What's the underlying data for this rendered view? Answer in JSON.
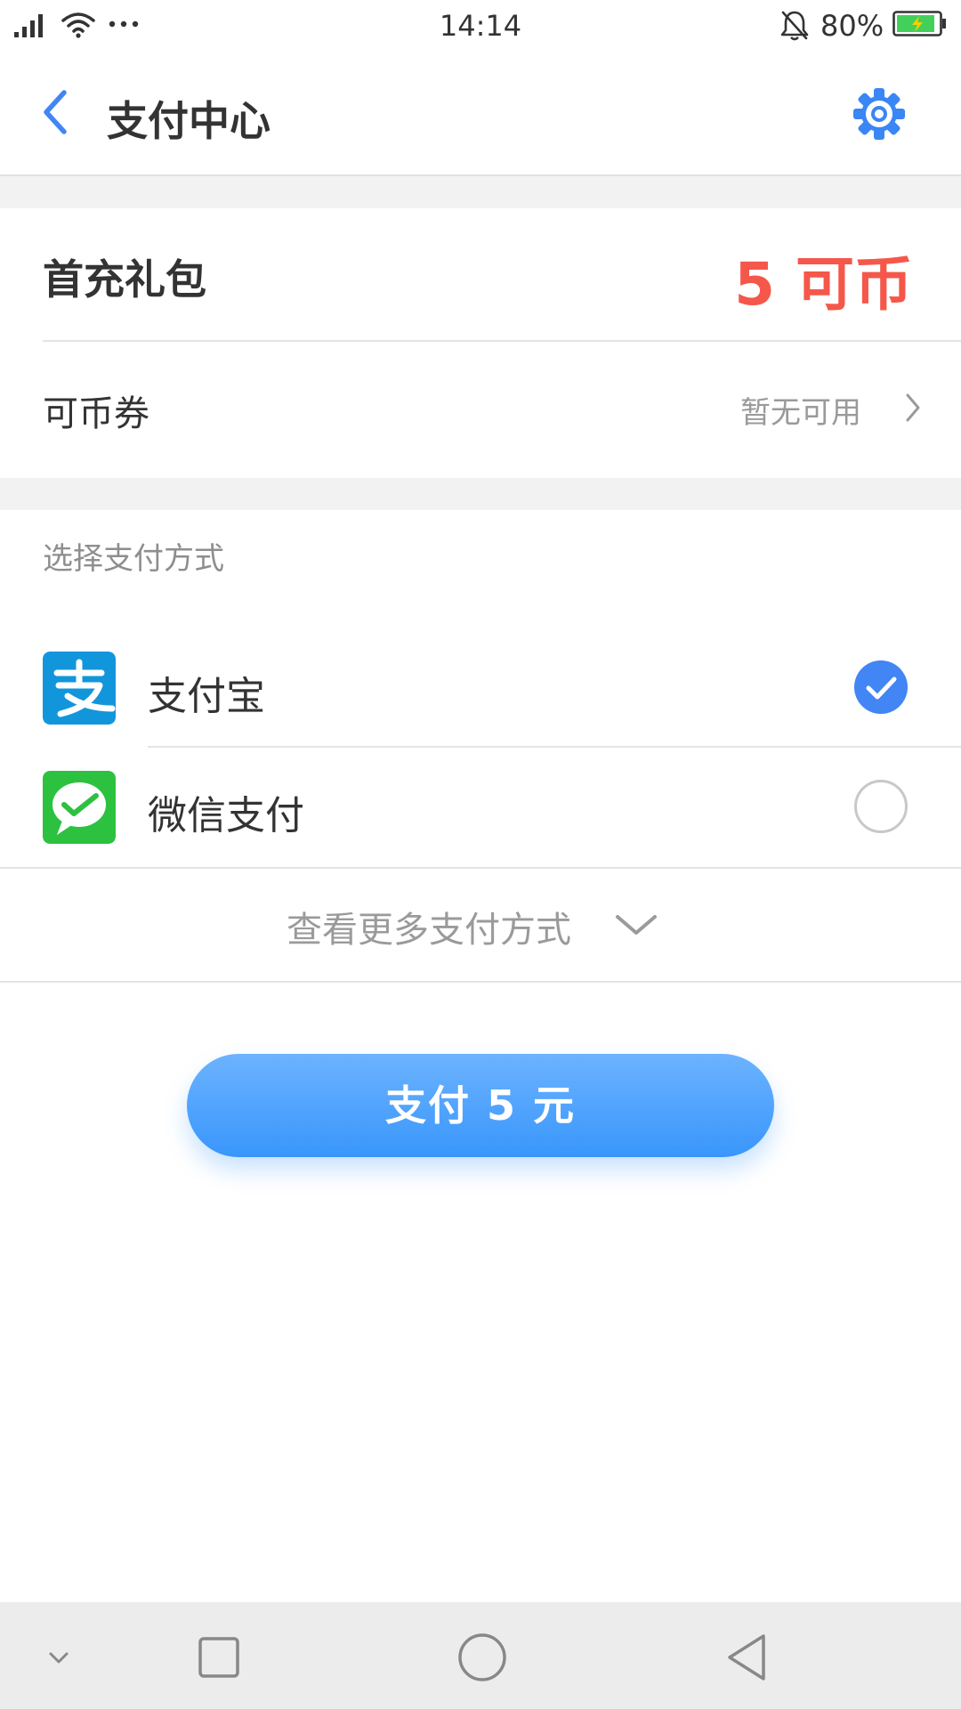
{
  "status_bar": {
    "time": "14:14",
    "battery_percent": "80%",
    "icons": [
      "signal-icon",
      "wifi-icon",
      "more-dots-icon",
      "bell-mute-icon",
      "battery-charging-icon"
    ]
  },
  "header": {
    "title": "支付中心",
    "back_icon": "back-arrow-icon",
    "settings_icon": "gear-icon"
  },
  "gift": {
    "label": "首充礼包",
    "value": "5 可币"
  },
  "coupon": {
    "label": "可币券",
    "status": "暂无可用"
  },
  "payment_methods": {
    "section_title": "选择支付方式",
    "items": [
      {
        "label": "支付宝",
        "icon": "alipay-icon",
        "selected": true
      },
      {
        "label": "微信支付",
        "icon": "wechat-pay-icon",
        "selected": false
      }
    ],
    "more_label": "查看更多支付方式"
  },
  "pay_button": {
    "label": "支付 5 元"
  },
  "colors": {
    "accent_blue": "#4285f4",
    "gift_red": "#f5574a",
    "alipay_blue": "#1296db",
    "wechat_green": "#2dc140",
    "button_gradient_top": "#6cb3ff",
    "button_gradient_bottom": "#3996fb"
  },
  "nav_bar": {
    "icons": [
      "nav-hide-icon",
      "nav-recents-icon",
      "nav-home-icon",
      "nav-back-icon"
    ]
  }
}
